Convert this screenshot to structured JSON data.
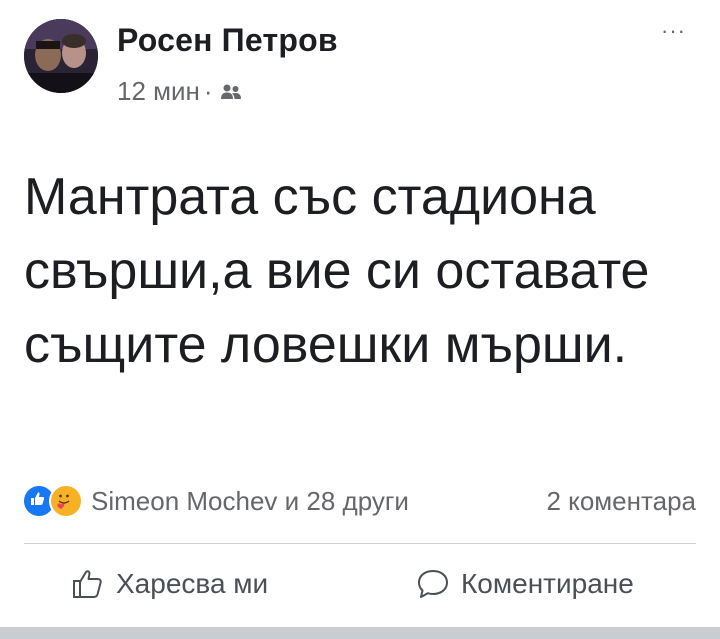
{
  "post": {
    "author": {
      "name": "Росен Петров",
      "avatar_icon": "profile-photo"
    },
    "time": "12 мин",
    "separator": "·",
    "audience_icon": "friends-icon",
    "more_icon": "more-options-icon",
    "more_label": "···",
    "text": "Мантрата със стадиона свърши,а вие си оставате същите ловешки мърши.",
    "reactions": {
      "icons": [
        "like-reaction-icon",
        "care-reaction-icon"
      ],
      "summary": "Simeon Mochev и 28 други"
    },
    "comments_count": "2 коментара",
    "actions": {
      "like_label": "Харесва ми",
      "comment_label": "Коментиране"
    }
  },
  "colors": {
    "text": "#1c1e21",
    "secondary": "#65676b",
    "like_blue": "#1877f2",
    "care_yellow": "#f7b125",
    "divider": "#ced0d4"
  }
}
